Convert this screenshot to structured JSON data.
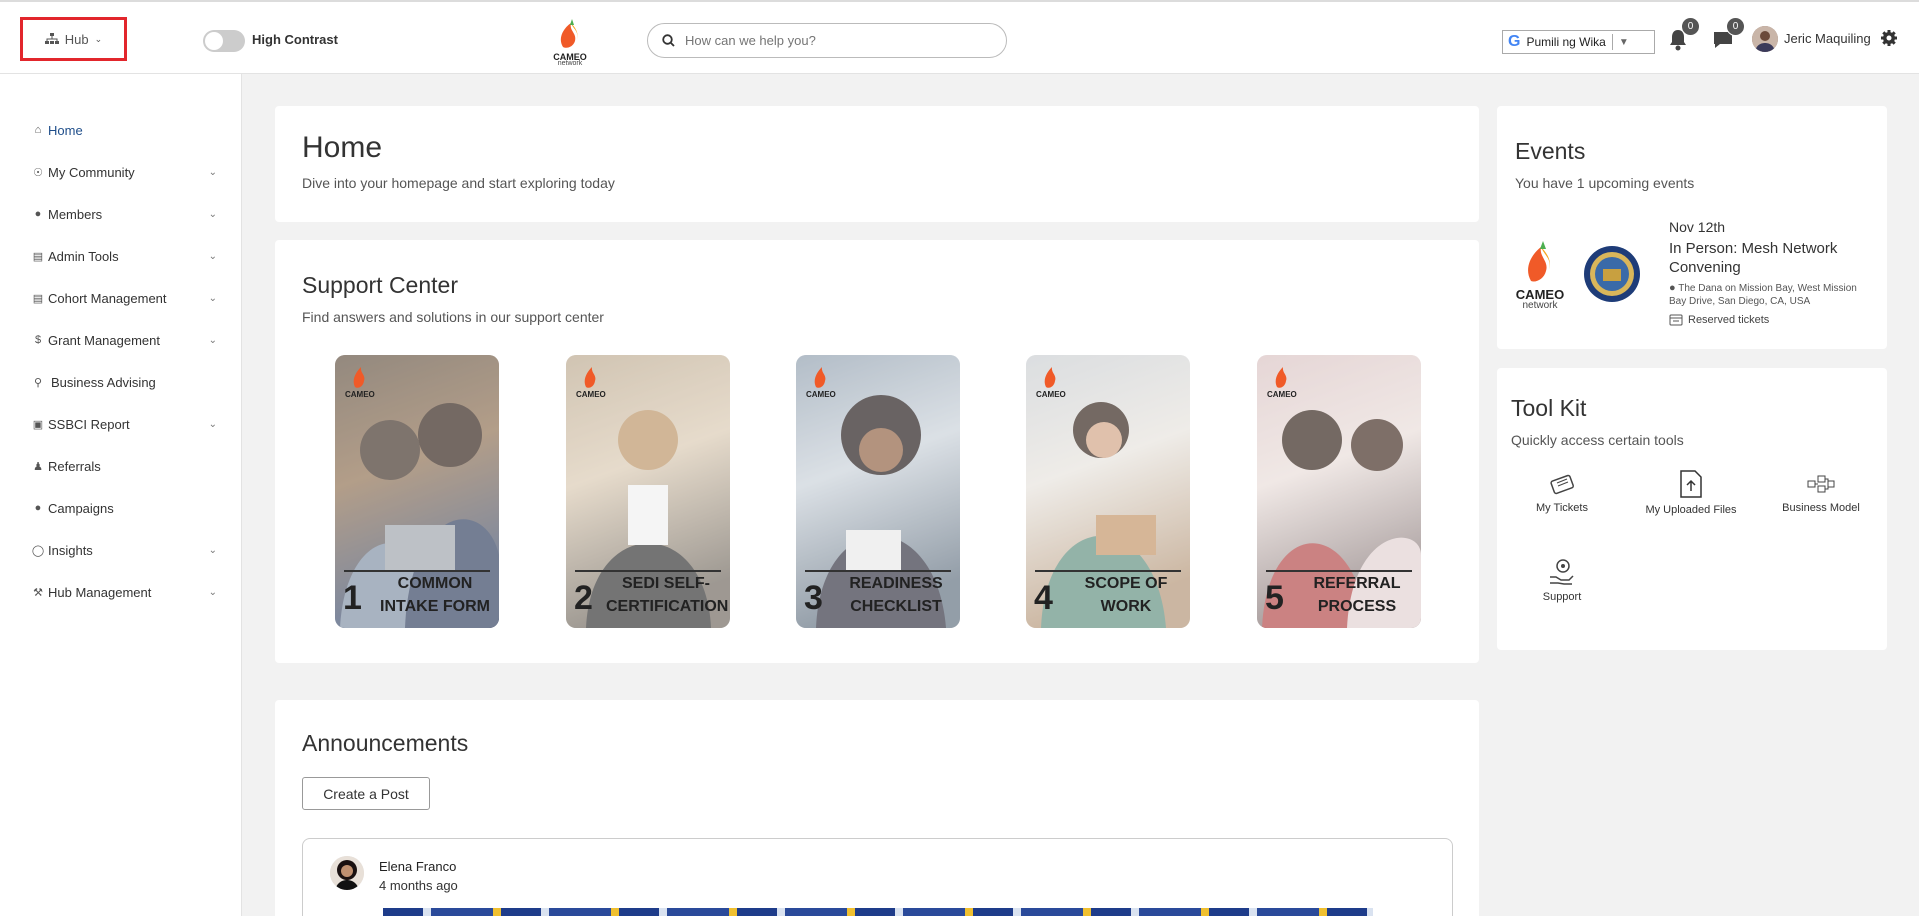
{
  "header": {
    "hub_label": "Hub",
    "high_contrast_label": "High Contrast",
    "logo_text": "CAMEO",
    "logo_sub": "network",
    "search_placeholder": "How can we help you?",
    "translate_label": "Pumili ng Wika",
    "notifications_count": "0",
    "messages_count": "0",
    "user_name": "Jeric Maquiling"
  },
  "sidebar": {
    "items": [
      {
        "label": "Home",
        "icon": "home-icon",
        "has_chevron": false
      },
      {
        "label": "My Community",
        "icon": "community-icon",
        "has_chevron": true
      },
      {
        "label": "Members",
        "icon": "user-circle-icon",
        "has_chevron": true
      },
      {
        "label": "Admin Tools",
        "icon": "tools-icon",
        "has_chevron": true
      },
      {
        "label": "Cohort Management",
        "icon": "list-icon",
        "has_chevron": true
      },
      {
        "label": "Grant Management",
        "icon": "dollar-icon",
        "has_chevron": true
      },
      {
        "label": "Business Advising",
        "icon": "key-icon",
        "has_chevron": false
      },
      {
        "label": "SSBCI Report",
        "icon": "file-icon",
        "has_chevron": true
      },
      {
        "label": "Referrals",
        "icon": "user-plus-icon",
        "has_chevron": false
      },
      {
        "label": "Campaigns",
        "icon": "comment-icon",
        "has_chevron": false
      },
      {
        "label": "Insights",
        "icon": "lightbulb-icon",
        "has_chevron": true
      },
      {
        "label": "Hub Management",
        "icon": "wrench-icon",
        "has_chevron": true
      }
    ]
  },
  "home": {
    "title": "Home",
    "subtitle": "Dive into your homepage and start exploring today"
  },
  "support": {
    "title": "Support Center",
    "subtitle": "Find answers and solutions in our support center",
    "tiles": [
      {
        "num": "1",
        "title": "COMMON INTAKE FORM"
      },
      {
        "num": "2",
        "title": "SEDI SELF-CERTIFICATION"
      },
      {
        "num": "3",
        "title": "READINESS CHECKLIST"
      },
      {
        "num": "4",
        "title": "SCOPE OF WORK"
      },
      {
        "num": "5",
        "title": "REFERRAL PROCESS"
      }
    ]
  },
  "announcements": {
    "title": "Announcements",
    "create_post": "Create a Post",
    "post": {
      "author": "Elena Franco",
      "time": "4 months ago"
    }
  },
  "events": {
    "title": "Events",
    "subtitle": "You have 1 upcoming events",
    "item": {
      "date": "Nov 12th",
      "name": "In Person: Mesh Network Convening",
      "location": "The Dana on Mission Bay, West Mission Bay Drive, San Diego, CA, USA",
      "tickets": "Reserved tickets"
    }
  },
  "toolkit": {
    "title": "Tool Kit",
    "subtitle": "Quickly access certain tools",
    "tools": [
      {
        "label": "My Tickets",
        "icon": "ticket-icon"
      },
      {
        "label": "My Uploaded Files",
        "icon": "file-upload-icon"
      },
      {
        "label": "Business Model",
        "icon": "flowchart-icon"
      },
      {
        "label": "Support",
        "icon": "support-hand-icon"
      }
    ]
  },
  "colors": {
    "accent": "#1f4e8a",
    "highlight_border": "#e2262c"
  }
}
